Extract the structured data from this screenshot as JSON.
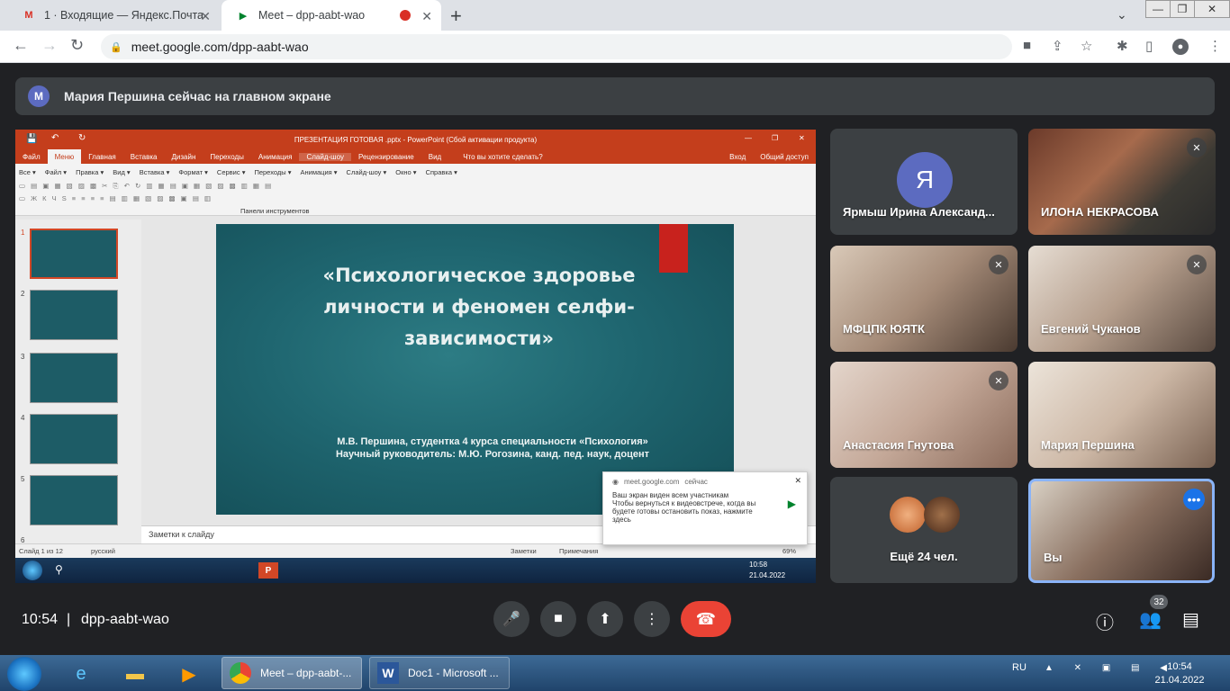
{
  "browser": {
    "tabs": [
      {
        "label": "1 · Входящие — Яндекс.Почта",
        "favicon": "gmail-icon"
      },
      {
        "label": "Meet – dpp-aabt-wao",
        "favicon": "meet-icon"
      }
    ],
    "url": "meet.google.com/dpp-aabt-wao"
  },
  "meet": {
    "presenter_banner": "Мария Першина сейчас на главном экране",
    "presenter_initial": "М",
    "time": "10:54",
    "meeting_code": "dpp-aabt-wao",
    "people_count": "32",
    "participants": [
      {
        "name": "Ярмыш Ирина Александ...",
        "initial": "Я",
        "muted": false
      },
      {
        "name": "ИЛОНА НЕКРАСОВА",
        "muted": true
      },
      {
        "name": "МФЦПК ЮЯТК",
        "muted": true
      },
      {
        "name": "Евгений Чуканов",
        "muted": true
      },
      {
        "name": "Анастасия Гнутова",
        "muted": true
      },
      {
        "name": "Мария Першина",
        "muted": false
      }
    ],
    "more_label": "Ещё 24 чел.",
    "you_label": "Вы"
  },
  "powerpoint": {
    "title": "ПРЕЗЕНТАЦИЯ ГОТОВАЯ .pptx - PowerPoint (Сбой активации продукта)",
    "menu": [
      "Файл",
      "Меню",
      "Главная",
      "Вставка",
      "Дизайн",
      "Переходы",
      "Анимация",
      "Слайд-шоу",
      "Рецензирование",
      "Вид"
    ],
    "tell_me": "Что вы хотите сделать?",
    "signin": "Вход",
    "share": "Общий доступ",
    "submenu": [
      "Все ▾",
      "Файл ▾",
      "Правка ▾",
      "Вид ▾",
      "Вставка ▾",
      "Формат ▾",
      "Сервис ▾",
      "Переходы ▾",
      "Анимация ▾",
      "Слайд-шоу ▾",
      "Окно ▾",
      "Справка ▾"
    ],
    "toolbars_label": "Панели инструментов",
    "slide_title": "«Психологическое здоровье личности и феномен селфи-зависимости»",
    "slide_sub1": "М.В. Першина,  студентка 4 курса специальности «Психология»",
    "slide_sub2": "Научный руководитель: М.Ю. Рогозина, канд. пед. наук, доцент",
    "notes": "Заметки к слайду",
    "status_slide": "Слайд 1 из 12",
    "status_lang": "русский",
    "status_notes": "Заметки",
    "status_comments": "Примечания",
    "zoom": "69%",
    "thumb_nums": [
      "1",
      "2",
      "3",
      "4",
      "5",
      "6"
    ],
    "inner_time": "10:58",
    "inner_date": "21.04.2022"
  },
  "notification": {
    "source": "meet.google.com",
    "when": "сейчас",
    "line1": "Ваш экран виден всем участникам",
    "line2": "Чтобы вернуться к видеовстрече, когда вы",
    "line3": "будете готовы остановить показ, нажмите",
    "line4": "здесь"
  },
  "taskbar": {
    "apps": [
      {
        "label": "Meet – dpp-aabt-...",
        "icon": "chrome-icon"
      },
      {
        "label": "Doc1 - Microsoft ...",
        "icon": "word-icon"
      }
    ],
    "lang": "RU",
    "time": "10:54",
    "date": "21.04.2022"
  }
}
